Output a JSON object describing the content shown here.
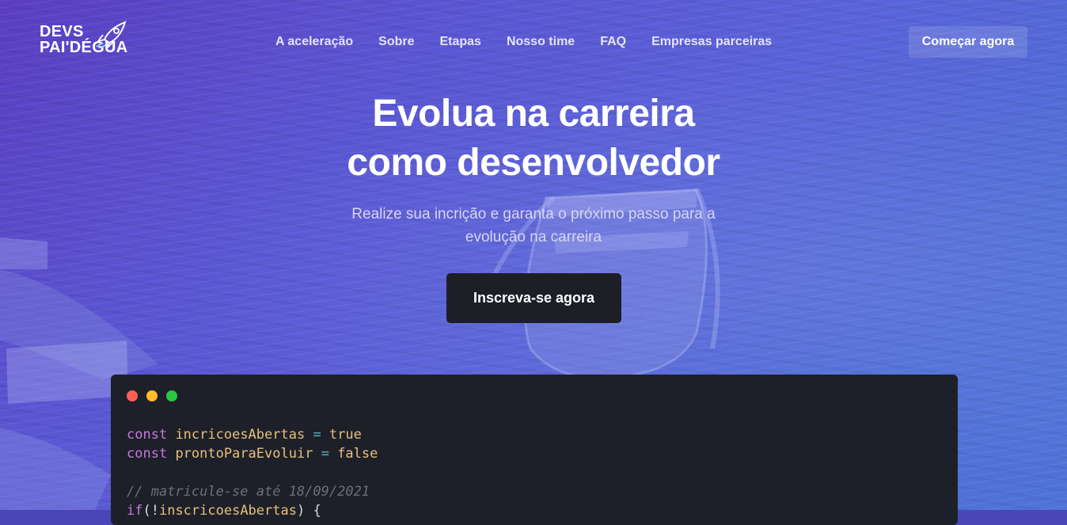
{
  "brand": {
    "line1": "DEVS",
    "line2": "PAI'DÉGUA",
    "icon": "rocket-icon"
  },
  "nav": {
    "items": [
      {
        "label": "A aceleração"
      },
      {
        "label": "Sobre"
      },
      {
        "label": "Etapas"
      },
      {
        "label": "Nosso time"
      },
      {
        "label": "FAQ"
      },
      {
        "label": "Empresas parceiras"
      }
    ],
    "cta_label": "Começar agora"
  },
  "hero": {
    "title_line1": "Evolua na carreira",
    "title_line2": "como desenvolvedor",
    "subtitle": "Realize sua incrição e garanta o próximo passo para a evolução na carreira",
    "cta_label": "Inscreva-se agora"
  },
  "code_window": {
    "line1": {
      "keyword": "const",
      "name": "incricoesAbertas",
      "op": "=",
      "value": "true"
    },
    "line2": {
      "keyword": "const",
      "name": "prontoParaEvoluir",
      "op": "=",
      "value": "false"
    },
    "comment": "// matricule-se até 18/09/2021",
    "line4": {
      "keyword": "if",
      "open": "(!",
      "name": "inscricoesAbertas",
      "close": ") {"
    }
  },
  "colors": {
    "background_gradient_start": "#5a3ec0",
    "background_gradient_end": "#4f73d8",
    "code_bg": "#1e2029",
    "cta_main_bg": "#1d1f27",
    "window_dot_red": "#ff5f57",
    "window_dot_yellow": "#febc2e",
    "window_dot_green": "#28c840"
  }
}
